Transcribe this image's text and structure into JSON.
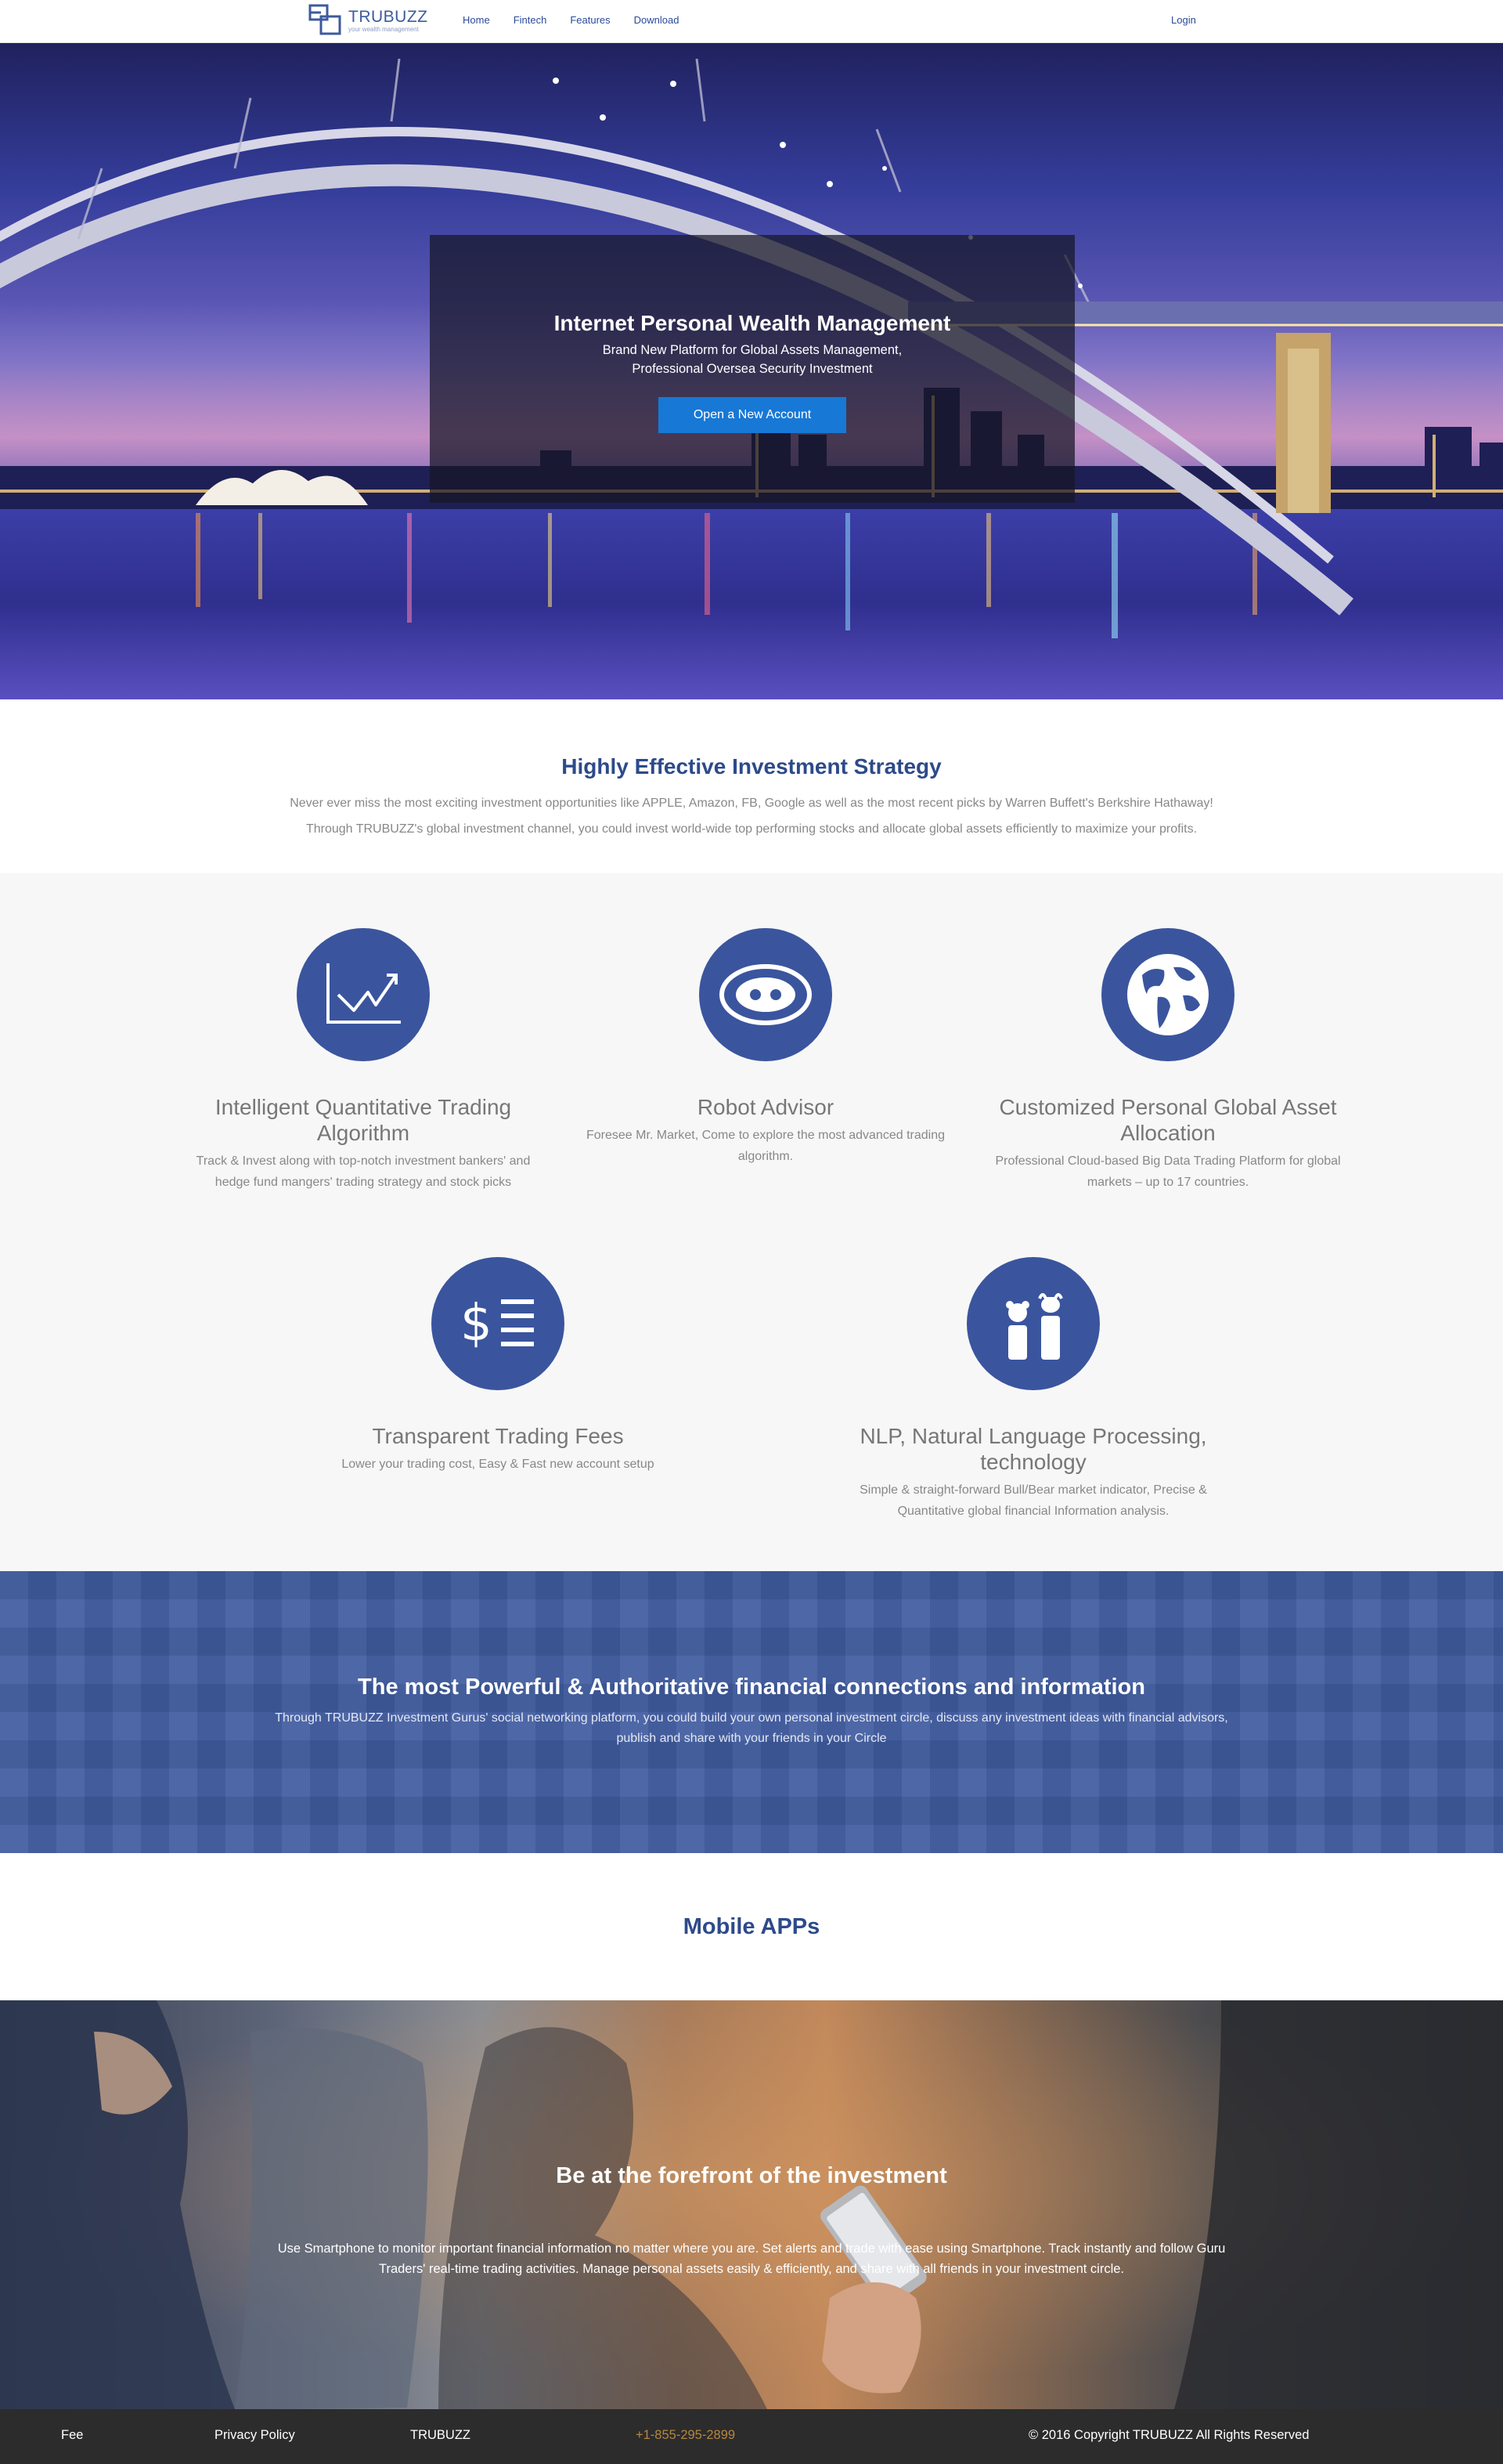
{
  "nav": {
    "logo_name": "TRUBUZZ",
    "logo_tagline": "your wealth management",
    "links": [
      "Home",
      "Fintech",
      "Features",
      "Download"
    ],
    "login": "Login"
  },
  "hero": {
    "title": "Internet Personal Wealth Management",
    "subtitle_line1": "Brand New Platform for Global Assets Management,",
    "subtitle_line2": "Professional Oversea Security Investment",
    "cta": "Open a New Account"
  },
  "strategy": {
    "title": "Highly Effective Investment Strategy",
    "line1": "Never ever miss the most exciting investment opportunities like APPLE, Amazon, FB, Google as well as the most recent picks by Warren Buffett's Berkshire Hathaway!",
    "line2": "Through TRUBUZZ's global investment channel, you could invest world-wide top performing stocks and allocate global assets efficiently to maximize your profits."
  },
  "features": [
    {
      "icon": "chart-line-icon",
      "title": "Intelligent Quantitative Trading Algorithm",
      "desc": "Track & Invest along with top-notch investment bankers' and hedge fund mangers' trading strategy and stock picks"
    },
    {
      "icon": "robot-face-icon",
      "title": "Robot Advisor",
      "desc": "Foresee Mr. Market, Come to explore the most advanced trading algorithm."
    },
    {
      "icon": "globe-icon",
      "title": "Customized Personal Global Asset Allocation",
      "desc": "Professional Cloud-based Big Data Trading Platform for global markets – up to 17 countries."
    },
    {
      "icon": "dollar-list-icon",
      "title": "Transparent Trading Fees",
      "desc": "Lower your trading cost, Easy & Fast new account setup"
    },
    {
      "icon": "bull-bear-icon",
      "title": "NLP, Natural Language Processing, technology",
      "desc": "Simple & straight-forward Bull/Bear market indicator, Precise & Quantitative global financial Information analysis."
    }
  ],
  "social": {
    "title": "The most Powerful & Authoritative financial connections and information",
    "line1": "Through TRUBUZZ Investment Gurus' social networking platform, you could build your own personal investment circle, discuss any investment ideas with financial advisors,",
    "line2": "publish and share with your friends in your Circle"
  },
  "mobile": {
    "title": "Mobile APPs"
  },
  "forefront": {
    "title": "Be at the forefront of the investment",
    "line1": "Use Smartphone to monitor important financial information no matter where you are. Set alerts and trade with ease using Smartphone. Track instantly and follow Guru",
    "line2": "Traders' real-time trading activities. Manage personal assets easily & efficiently, and share with all friends in your investment circle."
  },
  "footer": {
    "fee": "Fee",
    "privacy": "Privacy Policy",
    "brand": "TRUBUZZ",
    "phone": "+1-855-295-2899",
    "copyright": "© 2016 Copyright TRUBUZZ All Rights Reserved"
  },
  "colors": {
    "brand_blue": "#3a559e",
    "cta_blue": "#1878d6",
    "heading_blue": "#2d4a8a",
    "footer_bg": "#2c2c2c",
    "phone_gold": "#b5863f"
  }
}
